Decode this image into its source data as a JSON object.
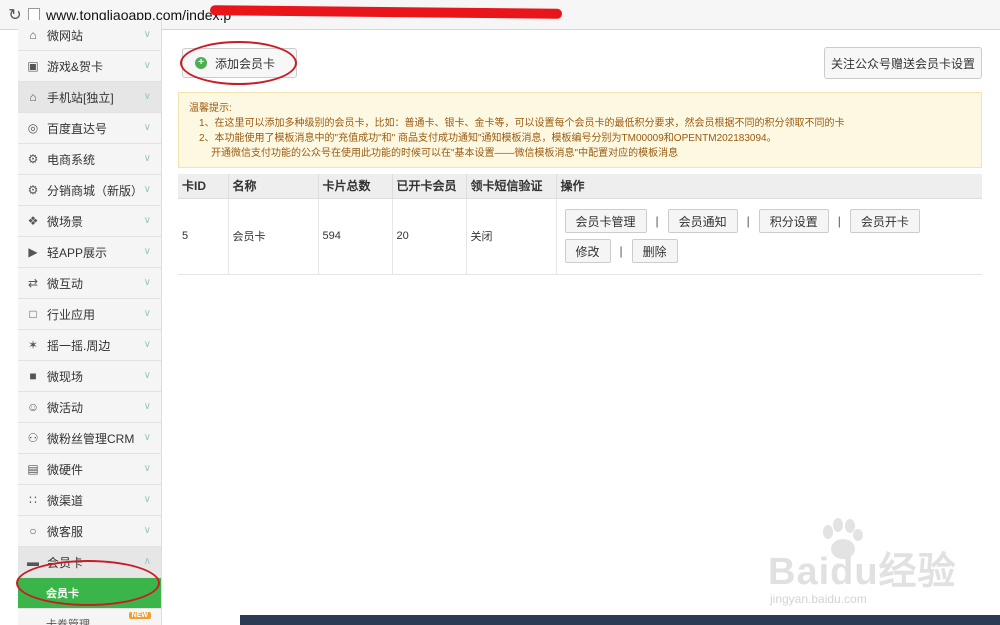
{
  "browser": {
    "url": "www.tongliaoapp.com/index.p",
    "reload_icon": "reload-icon"
  },
  "sidebar": {
    "items": [
      {
        "label": "微网站",
        "icon": "home-icon"
      },
      {
        "label": "游戏&贺卡",
        "icon": "gamepad-icon"
      },
      {
        "label": "手机站[独立]",
        "icon": "home-icon"
      },
      {
        "label": "百度直达号",
        "icon": "baidu-icon"
      },
      {
        "label": "电商系统",
        "icon": "gear-icon"
      },
      {
        "label": "分销商城（新版）",
        "icon": "gear-icon"
      },
      {
        "label": "微场景",
        "icon": "scene-icon"
      },
      {
        "label": "轻APP展示",
        "icon": "video-icon"
      },
      {
        "label": "微互动",
        "icon": "interact-icon"
      },
      {
        "label": "行业应用",
        "icon": "app-icon"
      },
      {
        "label": "摇一摇.周边",
        "icon": "shake-icon"
      },
      {
        "label": "微现场",
        "icon": "camera-icon"
      },
      {
        "label": "微活动",
        "icon": "activity-icon"
      },
      {
        "label": "微粉丝管理CRM",
        "icon": "users-icon"
      },
      {
        "label": "微硬件",
        "icon": "hardware-icon"
      },
      {
        "label": "微渠道",
        "icon": "channel-icon"
      },
      {
        "label": "微客服",
        "icon": "chat-icon"
      },
      {
        "label": "会员卡",
        "icon": "card-icon"
      }
    ],
    "active_sub": "会员卡",
    "next_sub": "卡券管理",
    "new_badge": "NEW"
  },
  "toolbar": {
    "add_label": "添加会员卡",
    "follow_label": "关注公众号赠送会员卡设置"
  },
  "notice": {
    "title": "温馨提示:",
    "line1": "1、在这里可以添加多种级别的会员卡，比如：普通卡、银卡、金卡等，可以设置每个会员卡的最低积分要求，然会员根据不同的积分领取不同的卡",
    "line2": "2、本功能使用了模板消息中的\"充值成功\"和\" 商品支付成功通知\"通知模板消息，模板编号分别为TM00009和OPENTM202183094。",
    "line3": "开通微信支付功能的公众号在使用此功能的时候可以在\"基本设置——微信模板消息\"中配置对应的模板消息"
  },
  "table": {
    "headers": [
      "卡ID",
      "名称",
      "卡片总数",
      "已开卡会员",
      "领卡短信验证",
      "操作"
    ],
    "rows": [
      {
        "id": "5",
        "name": "会员卡",
        "total": "594",
        "opened": "20",
        "sms": "关闭"
      }
    ],
    "ops": [
      "会员卡管理",
      "会员通知",
      "积分设置",
      "会员开卡",
      "修改",
      "删除"
    ],
    "separator": "|"
  },
  "watermark": {
    "text": "Baidu经验",
    "url": "jingyan.baidu.com"
  },
  "colors": {
    "accent": "#3bb44a",
    "annotation": "#c81d25",
    "notice_text": "#9a5a10"
  }
}
